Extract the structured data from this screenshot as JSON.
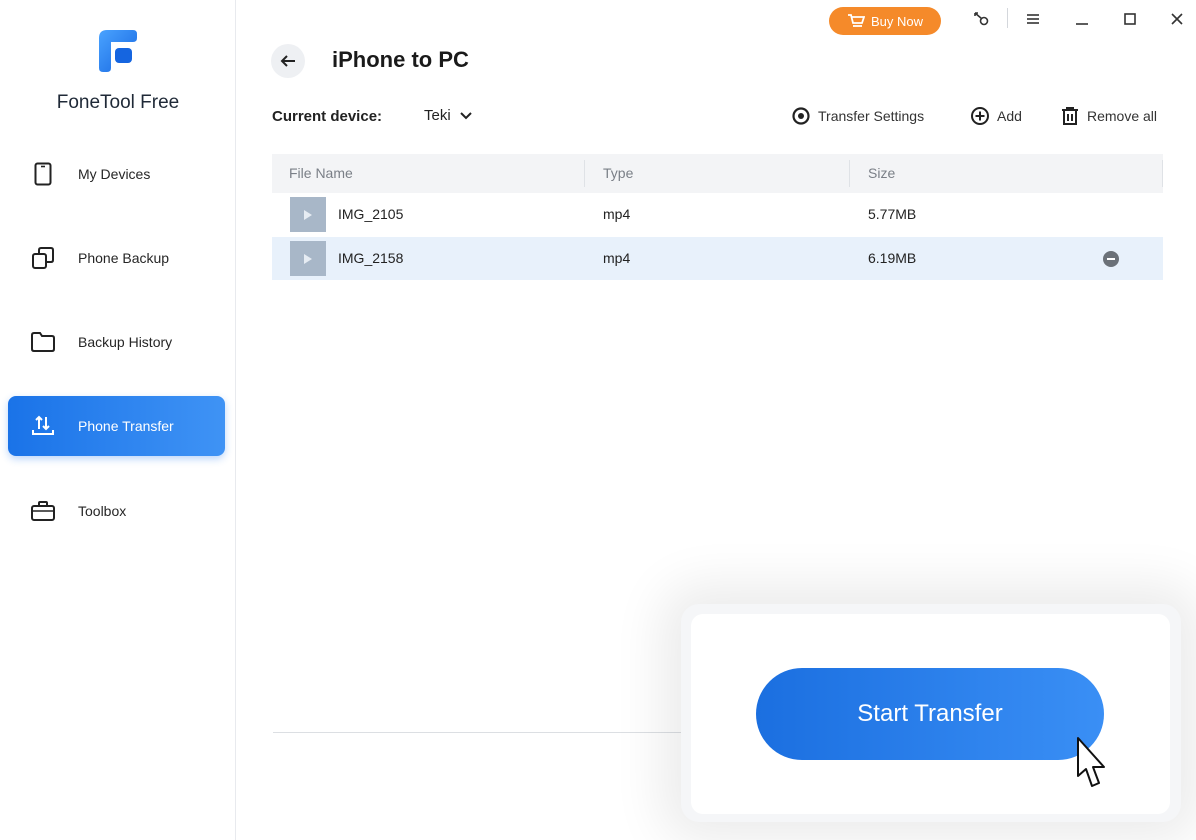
{
  "app": {
    "name": "FoneTool Free",
    "brand_color": "#1a73e8",
    "accent_color": "#f58a2a"
  },
  "sidebar": {
    "items": [
      {
        "label": "My Devices",
        "icon": "phone-icon",
        "active": false
      },
      {
        "label": "Phone Backup",
        "icon": "copy-icon",
        "active": false
      },
      {
        "label": "Backup History",
        "icon": "folder-icon",
        "active": false
      },
      {
        "label": "Phone Transfer",
        "icon": "transfer-icon",
        "active": true
      },
      {
        "label": "Toolbox",
        "icon": "briefcase-icon",
        "active": false
      }
    ]
  },
  "titlebar": {
    "buy_now": "Buy Now",
    "icons": [
      "key-icon",
      "menu-icon",
      "minimize-icon",
      "maximize-icon",
      "close-icon"
    ]
  },
  "header": {
    "title": "iPhone to PC"
  },
  "device": {
    "label": "Current device:",
    "value": "Teki"
  },
  "toolbar": {
    "transfer_settings": "Transfer Settings",
    "add": "Add",
    "remove_all": "Remove all"
  },
  "table": {
    "columns": [
      "File Name",
      "Type",
      "Size"
    ],
    "rows": [
      {
        "name": "IMG_2105",
        "type": "mp4",
        "size": "5.77MB",
        "selected": false
      },
      {
        "name": "IMG_2158",
        "type": "mp4",
        "size": "6.19MB",
        "selected": true
      }
    ]
  },
  "action": {
    "start_transfer": "Start Transfer"
  }
}
